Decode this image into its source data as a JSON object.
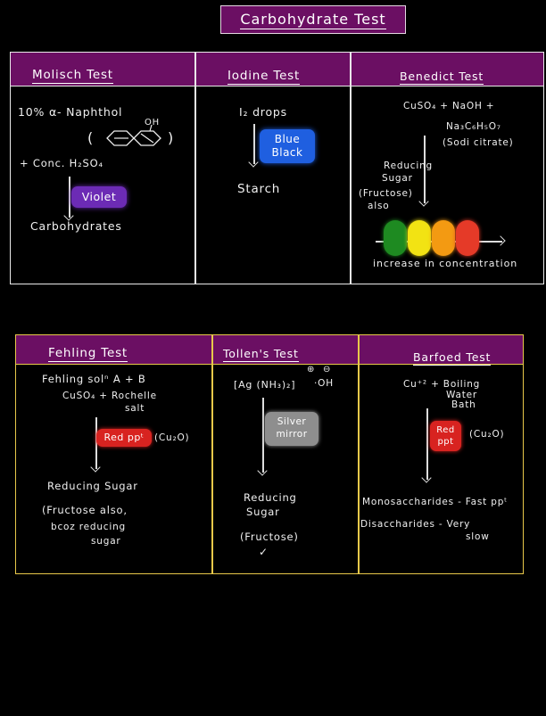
{
  "title": "Carbohydrate Test",
  "table1": {
    "headers": [
      "Molisch Test",
      "Iodine Test",
      "Benedict Test"
    ],
    "molisch": {
      "reagent1": "10% α- Naphthol",
      "structure_open": "(",
      "structure_close": ")",
      "oh": "OH",
      "reagent2": "+ Conc. H₂SO₄",
      "result": "Violet",
      "subject": "Carbohydrates"
    },
    "iodine": {
      "reagent": "I₂ drops",
      "result_line1": "Blue",
      "result_line2": "Black",
      "subject": "Starch"
    },
    "benedict": {
      "reagent_line1": "CuSO₄ + NaOH +",
      "reagent_line2": "Na₃C₆H₅O₇",
      "reagent_line3": "(Sodi citrate)",
      "subject_line1": "Reducing",
      "subject_line2": "Sugar",
      "subject_line3": "(Fructose)",
      "subject_line4": "also",
      "gradient_colors": [
        "#1e8a21",
        "#f2e313",
        "#f39a12",
        "#e53a28"
      ],
      "scale_label": "increase in concentration"
    }
  },
  "table2": {
    "headers": [
      "Fehling Test",
      "Tollen's Test",
      "Barfoed Test"
    ],
    "fehling": {
      "reagent_line1": "Fehling solⁿ A + B",
      "reagent_line2": "CuSO₄ + Rochelle",
      "reagent_line3": "salt",
      "result": "Red ppᵗ",
      "formula": "(Cu₂O)",
      "subject_line1": "Reducing Sugar",
      "subject_line2": "(Fructose also,",
      "subject_line3": "bcoz reducing",
      "subject_line4": "sugar"
    },
    "tollen": {
      "reagent": "[Ag (NH₃)₂]",
      "charge_plus": "⊕",
      "charge_minus": "⊖",
      "oh": "·OH",
      "result_line1": "Silver",
      "result_line2": "mirror",
      "subject_line1": "Reducing",
      "subject_line2": "Sugar",
      "subject_line3": "(Fructose)",
      "tick": "✓"
    },
    "barfoed": {
      "reagent": "Cu⁺² + Boiling",
      "reagent_line2": "Water",
      "reagent_line3": "Bath",
      "result_line1": "Red",
      "result_line2": "ppt",
      "formula": "(Cu₂O)",
      "mono": "Monosaccharides - Fast ppᵗ",
      "di": "Disaccharides - Very",
      "di_line2": "slow"
    }
  },
  "colors": {
    "header_bg": "#6b0f63",
    "violet": "#6c2bb5",
    "blue": "#1f5fe0",
    "red": "#d82320",
    "silver": "#8e8e8e",
    "border_yellow": "#e8c84a"
  }
}
